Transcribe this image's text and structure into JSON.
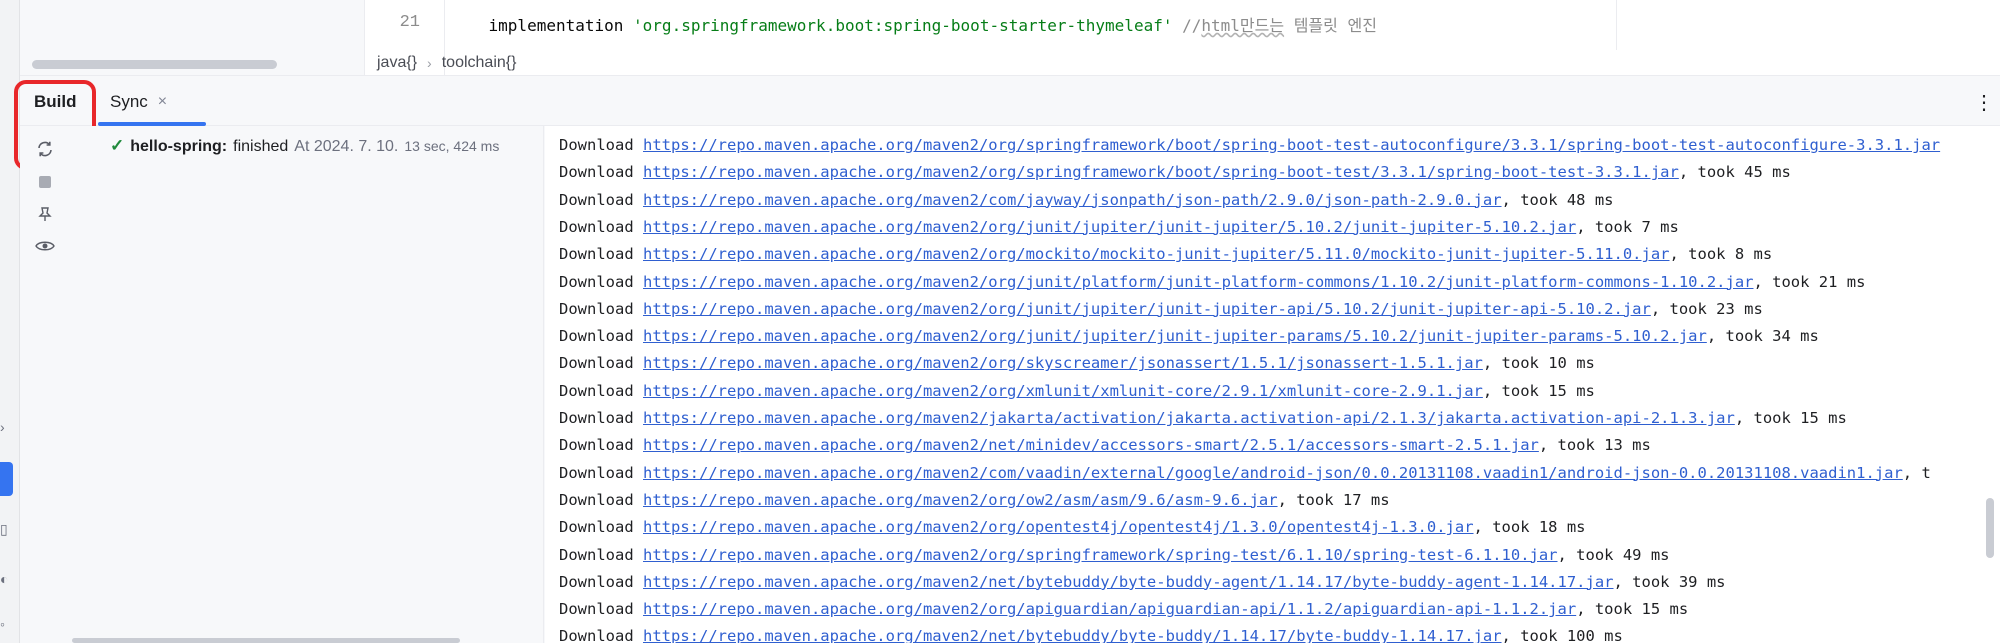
{
  "editor": {
    "line_numbers": [
      "21"
    ],
    "code_line": {
      "keyword": "implementation",
      "string": "'org.springframework.boot:spring-boot-starter-thymeleaf'",
      "comment_prefix": "//",
      "comment_underlined": "html만드는",
      "comment_rest": " 템플릿 엔진"
    },
    "breadcrumb": [
      "java{}",
      "toolchain{}"
    ]
  },
  "tabs": [
    {
      "label": "Build",
      "active": true
    },
    {
      "label": "Sync",
      "closable": true,
      "close_glyph": "×"
    }
  ],
  "more_glyph": "⋮",
  "toolbar": {
    "icons": [
      "sync-icon",
      "stop-icon",
      "pin-icon",
      "eye-icon"
    ],
    "highlight_color": "#e8272a"
  },
  "build_tree": {
    "project": "hello-spring:",
    "status": "finished",
    "timestamp": "At 2024. 7. 10.",
    "duration": "13 sec, 424 ms"
  },
  "console": {
    "prefix": "Download",
    "lines": [
      {
        "url": "https://repo.maven.apache.org/maven2/org/springframework/boot/spring-boot-test-autoconfigure/3.3.1/spring-boot-test-autoconfigure-3.3.1.jar",
        "took": ""
      },
      {
        "url": "https://repo.maven.apache.org/maven2/org/springframework/boot/spring-boot-test/3.3.1/spring-boot-test-3.3.1.jar",
        "took": ", took 45 ms"
      },
      {
        "url": "https://repo.maven.apache.org/maven2/com/jayway/jsonpath/json-path/2.9.0/json-path-2.9.0.jar",
        "took": ", took 48 ms"
      },
      {
        "url": "https://repo.maven.apache.org/maven2/org/junit/jupiter/junit-jupiter/5.10.2/junit-jupiter-5.10.2.jar",
        "took": ", took 7 ms"
      },
      {
        "url": "https://repo.maven.apache.org/maven2/org/mockito/mockito-junit-jupiter/5.11.0/mockito-junit-jupiter-5.11.0.jar",
        "took": ", took 8 ms"
      },
      {
        "url": "https://repo.maven.apache.org/maven2/org/junit/platform/junit-platform-commons/1.10.2/junit-platform-commons-1.10.2.jar",
        "took": ", took 21 ms"
      },
      {
        "url": "https://repo.maven.apache.org/maven2/org/junit/jupiter/junit-jupiter-api/5.10.2/junit-jupiter-api-5.10.2.jar",
        "took": ", took 23 ms"
      },
      {
        "url": "https://repo.maven.apache.org/maven2/org/junit/jupiter/junit-jupiter-params/5.10.2/junit-jupiter-params-5.10.2.jar",
        "took": ", took 34 ms"
      },
      {
        "url": "https://repo.maven.apache.org/maven2/org/skyscreamer/jsonassert/1.5.1/jsonassert-1.5.1.jar",
        "took": ", took 10 ms"
      },
      {
        "url": "https://repo.maven.apache.org/maven2/org/xmlunit/xmlunit-core/2.9.1/xmlunit-core-2.9.1.jar",
        "took": ", took 15 ms"
      },
      {
        "url": "https://repo.maven.apache.org/maven2/jakarta/activation/jakarta.activation-api/2.1.3/jakarta.activation-api-2.1.3.jar",
        "took": ", took 15 ms"
      },
      {
        "url": "https://repo.maven.apache.org/maven2/net/minidev/accessors-smart/2.5.1/accessors-smart-2.5.1.jar",
        "took": ", took 13 ms"
      },
      {
        "url": "https://repo.maven.apache.org/maven2/com/vaadin/external/google/android-json/0.0.20131108.vaadin1/android-json-0.0.20131108.vaadin1.jar",
        "took": ", t"
      },
      {
        "url": "https://repo.maven.apache.org/maven2/org/ow2/asm/asm/9.6/asm-9.6.jar",
        "took": ", took 17 ms"
      },
      {
        "url": "https://repo.maven.apache.org/maven2/org/opentest4j/opentest4j/1.3.0/opentest4j-1.3.0.jar",
        "took": ", took 18 ms"
      },
      {
        "url": "https://repo.maven.apache.org/maven2/org/springframework/spring-test/6.1.10/spring-test-6.1.10.jar",
        "took": ", took 49 ms"
      },
      {
        "url": "https://repo.maven.apache.org/maven2/net/bytebuddy/byte-buddy-agent/1.14.17/byte-buddy-agent-1.14.17.jar",
        "took": ", took 39 ms"
      },
      {
        "url": "https://repo.maven.apache.org/maven2/org/apiguardian/apiguardian-api/1.1.2/apiguardian-api-1.1.2.jar",
        "took": ", took 15 ms"
      },
      {
        "url": "https://repo.maven.apache.org/maven2/net/bytebuddy/byte-buddy/1.14.17/byte-buddy-1.14.17.jar",
        "took": ", took 100 ms"
      }
    ]
  },
  "colors": {
    "accent": "#3574f0",
    "link": "#2f5fd0",
    "success": "#208a3c",
    "highlight": "#e8272a"
  }
}
